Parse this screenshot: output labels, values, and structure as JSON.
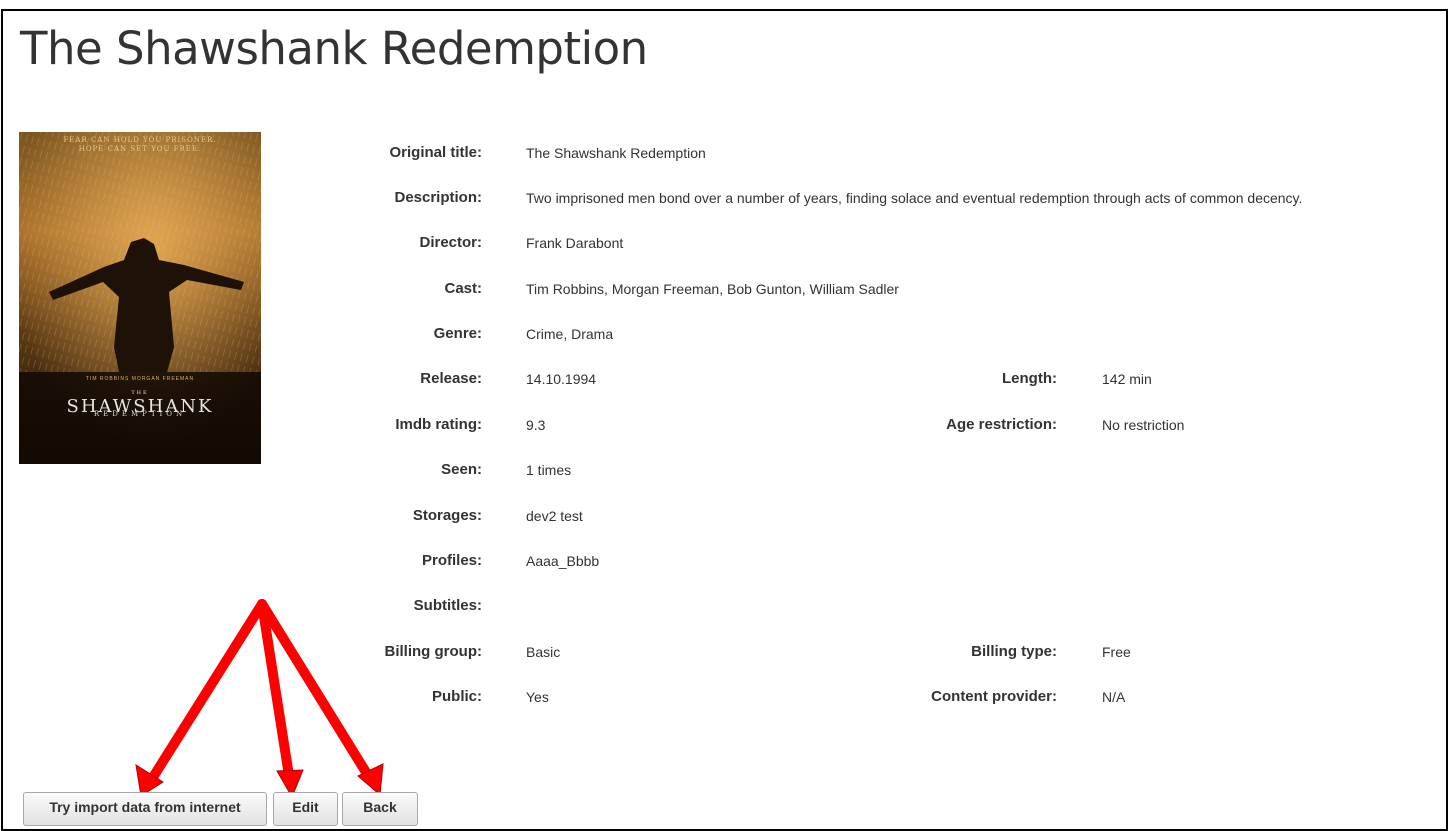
{
  "page": {
    "title": "The Shawshank Redemption"
  },
  "poster": {
    "tagline_line1": "FEAR CAN HOLD YOU PRISONER.",
    "tagline_line2": "HOPE CAN SET YOU FREE.",
    "cast_line": "TIM ROBBINS   MORGAN FREEMAN",
    "title_small": "THE",
    "title": "SHAWSHANK",
    "subtitle": "REDEMPTION"
  },
  "details": {
    "original_title": {
      "label": "Original title:",
      "value": "The Shawshank Redemption"
    },
    "description": {
      "label": "Description:",
      "value": "Two imprisoned men bond over a number of years, finding solace and eventual redemption through acts of common decency."
    },
    "director": {
      "label": "Director:",
      "value": "Frank Darabont"
    },
    "cast": {
      "label": "Cast:",
      "value": "Tim Robbins, Morgan Freeman, Bob Gunton, William Sadler"
    },
    "genre": {
      "label": "Genre:",
      "value": "Crime, Drama"
    },
    "release": {
      "label": "Release:",
      "value": "14.10.1994"
    },
    "length": {
      "label": "Length:",
      "value": "142 min"
    },
    "imdb_rating": {
      "label": "Imdb rating:",
      "value": "9.3"
    },
    "age_restriction": {
      "label": "Age restriction:",
      "value": "No restriction"
    },
    "seen": {
      "label": "Seen:",
      "value": "1 times"
    },
    "storages": {
      "label": "Storages:",
      "value": "dev2 test"
    },
    "profiles": {
      "label": "Profiles:",
      "value": "Aaaa_Bbbb"
    },
    "subtitles": {
      "label": "Subtitles:",
      "value": ""
    },
    "billing_group": {
      "label": "Billing group:",
      "value": "Basic"
    },
    "billing_type": {
      "label": "Billing type:",
      "value": "Free"
    },
    "public": {
      "label": "Public:",
      "value": "Yes"
    },
    "content_provider": {
      "label": "Content provider:",
      "value": "N/A"
    }
  },
  "buttons": {
    "import_label": "Try import data from internet",
    "edit_label": "Edit",
    "back_label": "Back"
  },
  "annotation": {
    "arrow_color": "#ff0000"
  }
}
